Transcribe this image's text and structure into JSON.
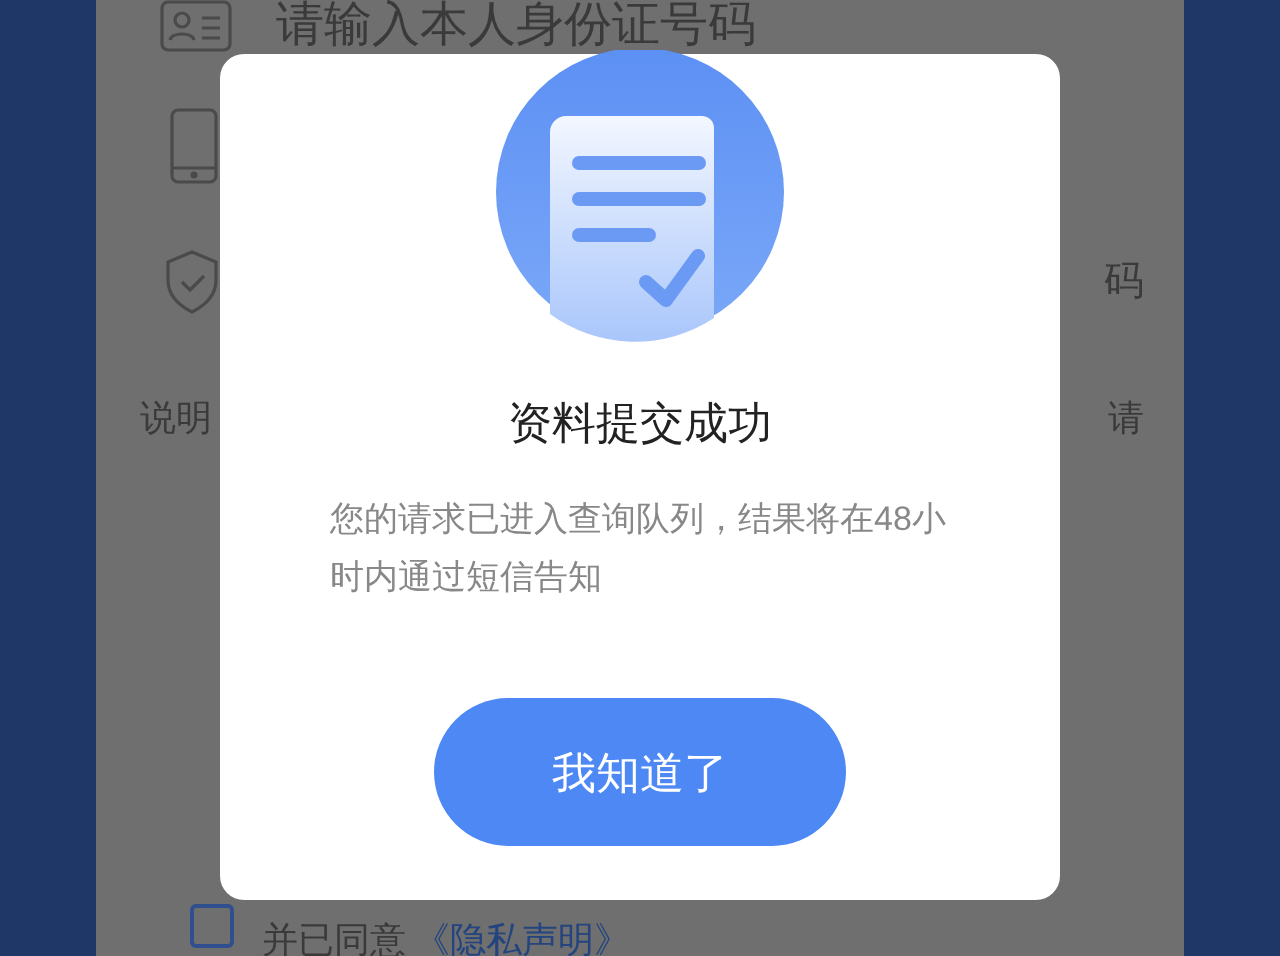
{
  "form": {
    "id_field": {
      "placeholder": "请输入本人身份证号码"
    },
    "code_field_tail": "码",
    "note_label": "说明",
    "note_tail": "请",
    "agreement": {
      "checked": false,
      "text": "并已同意",
      "link": "《隐私声明》"
    }
  },
  "dialog": {
    "title": "资料提交成功",
    "message": "您的请求已进入查询队列，结果将在48小时内通过短信告知",
    "button": "我知道了"
  }
}
